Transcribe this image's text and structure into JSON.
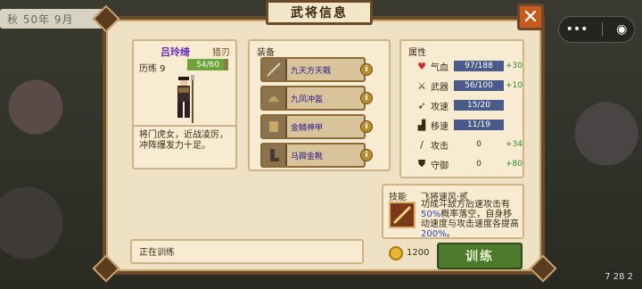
{
  "window": {
    "title": "武将信息",
    "close_label": "✕"
  },
  "top_status": "秋 50年 9月",
  "miniprogram": {
    "more_label": "•••",
    "target_label": "◉"
  },
  "version": "7 28 2",
  "hero": {
    "name": "吕玲绮",
    "type": "猎刃",
    "exp_label": "历练 9",
    "exp_value": "54/60",
    "exp_fraction": 0.9,
    "description": "将门虎女，近战凌厉，冲阵爆发力十足。"
  },
  "equipment": {
    "title": "装备",
    "items": [
      {
        "name": "九天方天戟",
        "info": "i"
      },
      {
        "name": "九凤冲盔",
        "info": "i"
      },
      {
        "name": "金鳞神甲",
        "info": "i"
      },
      {
        "name": "马蹄金靴",
        "info": "i"
      }
    ]
  },
  "attributes": {
    "title": "属性",
    "rows": [
      {
        "icon": "heart-icon",
        "name": "气血",
        "value": "97/188",
        "bonus": "+30",
        "bar": true
      },
      {
        "icon": "sword-icon",
        "name": "武器",
        "value": "56/100",
        "bonus": "+10",
        "bar": true
      },
      {
        "icon": "bow-icon",
        "name": "攻速",
        "value": "15/20",
        "bonus": "",
        "bar": true
      },
      {
        "icon": "boot-icon",
        "name": "移速",
        "value": "11/19",
        "bonus": "",
        "bar": true
      },
      {
        "icon": "blade-icon",
        "name": "攻击",
        "value": "0",
        "bonus": "+34",
        "bar": false
      },
      {
        "icon": "shield-icon",
        "name": "守御",
        "value": "0",
        "bonus": "+80",
        "bar": false
      }
    ]
  },
  "skill": {
    "label": "技能",
    "name": "飞将速风·贰",
    "desc_a": "功成斗敌方后速攻击有",
    "desc_pct1": "50%",
    "desc_b": "概率落空，自身移动速度与攻击速度各提高",
    "desc_pct2": "200%",
    "desc_c": "。"
  },
  "status_text": "正在训练",
  "gold": "1200",
  "train_label": "训练"
}
